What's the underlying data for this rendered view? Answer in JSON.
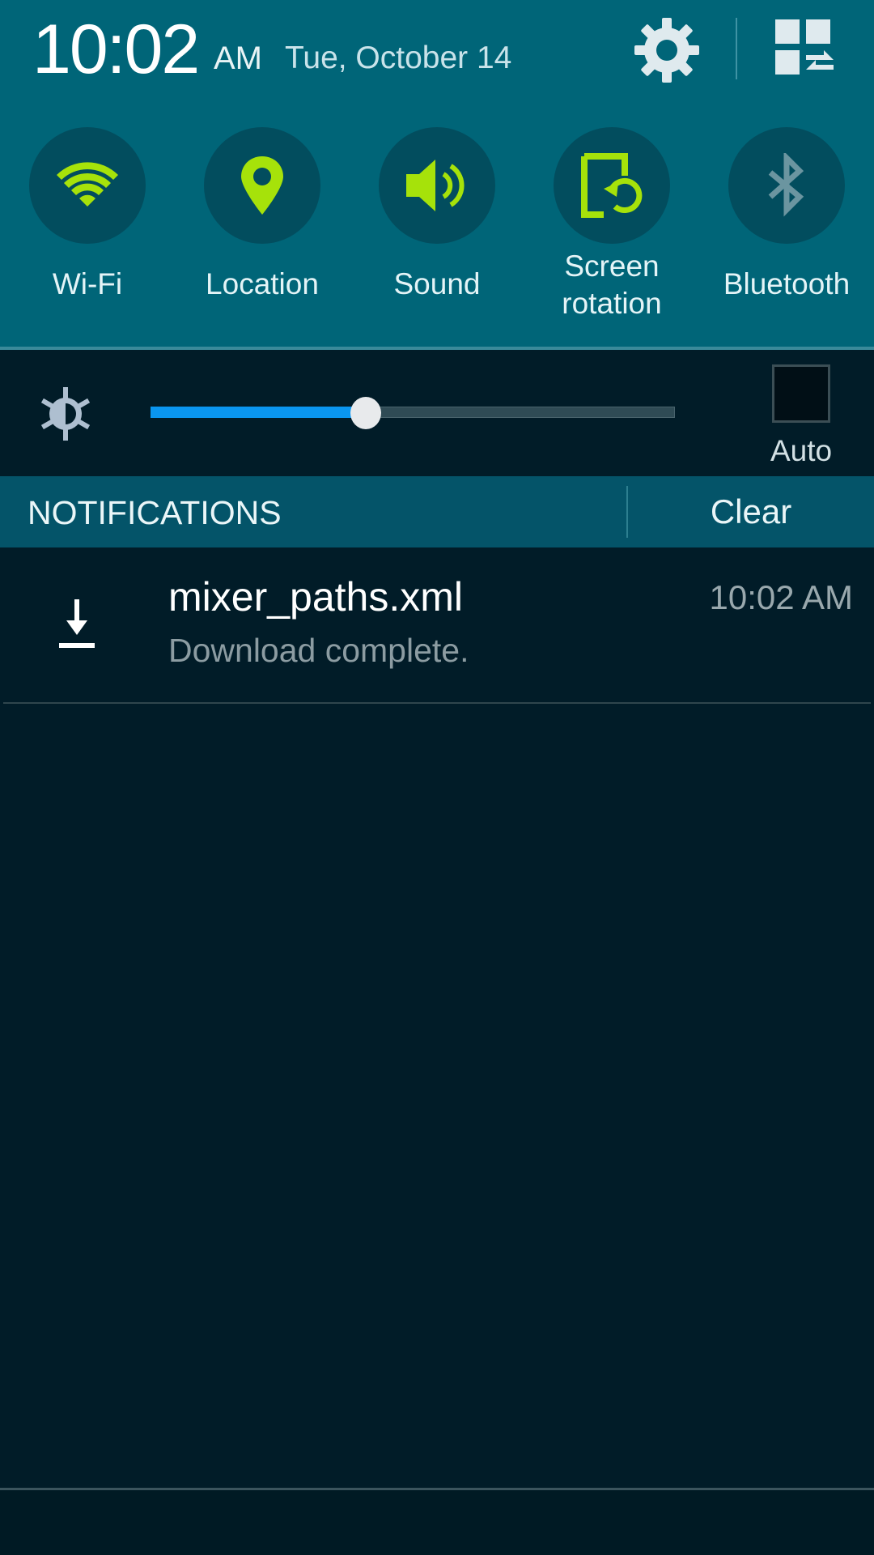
{
  "status": {
    "time": "10:02",
    "ampm": "AM",
    "date": "Tue, October 14"
  },
  "header_icons": {
    "settings": "gear-icon",
    "edit_quick_settings": "grid-swap-icon"
  },
  "quick_toggles": [
    {
      "label": "Wi-Fi",
      "icon": "wifi-icon",
      "active": true
    },
    {
      "label": "Location",
      "icon": "location-pin-icon",
      "active": true
    },
    {
      "label": "Sound",
      "icon": "speaker-icon",
      "active": true
    },
    {
      "label_line1": "Screen",
      "label_line2": "rotation",
      "icon": "screen-rotation-icon",
      "active": true
    },
    {
      "label": "Bluetooth",
      "icon": "bluetooth-icon",
      "active": false
    }
  ],
  "brightness": {
    "level": 0.41,
    "auto_label": "Auto",
    "auto_checked": false
  },
  "notifications": {
    "title": "NOTIFICATIONS",
    "clear_label": "Clear",
    "items": [
      {
        "title": "mixer_paths.xml",
        "message": "Download complete.",
        "time": "10:02 AM",
        "icon": "download-icon"
      }
    ]
  },
  "colors": {
    "header_bg": "#006578",
    "active_icon": "#a6e20a",
    "inactive_icon": "#6b95a0",
    "slider_fill": "#0a96f0",
    "panel_bg": "#011c28"
  }
}
